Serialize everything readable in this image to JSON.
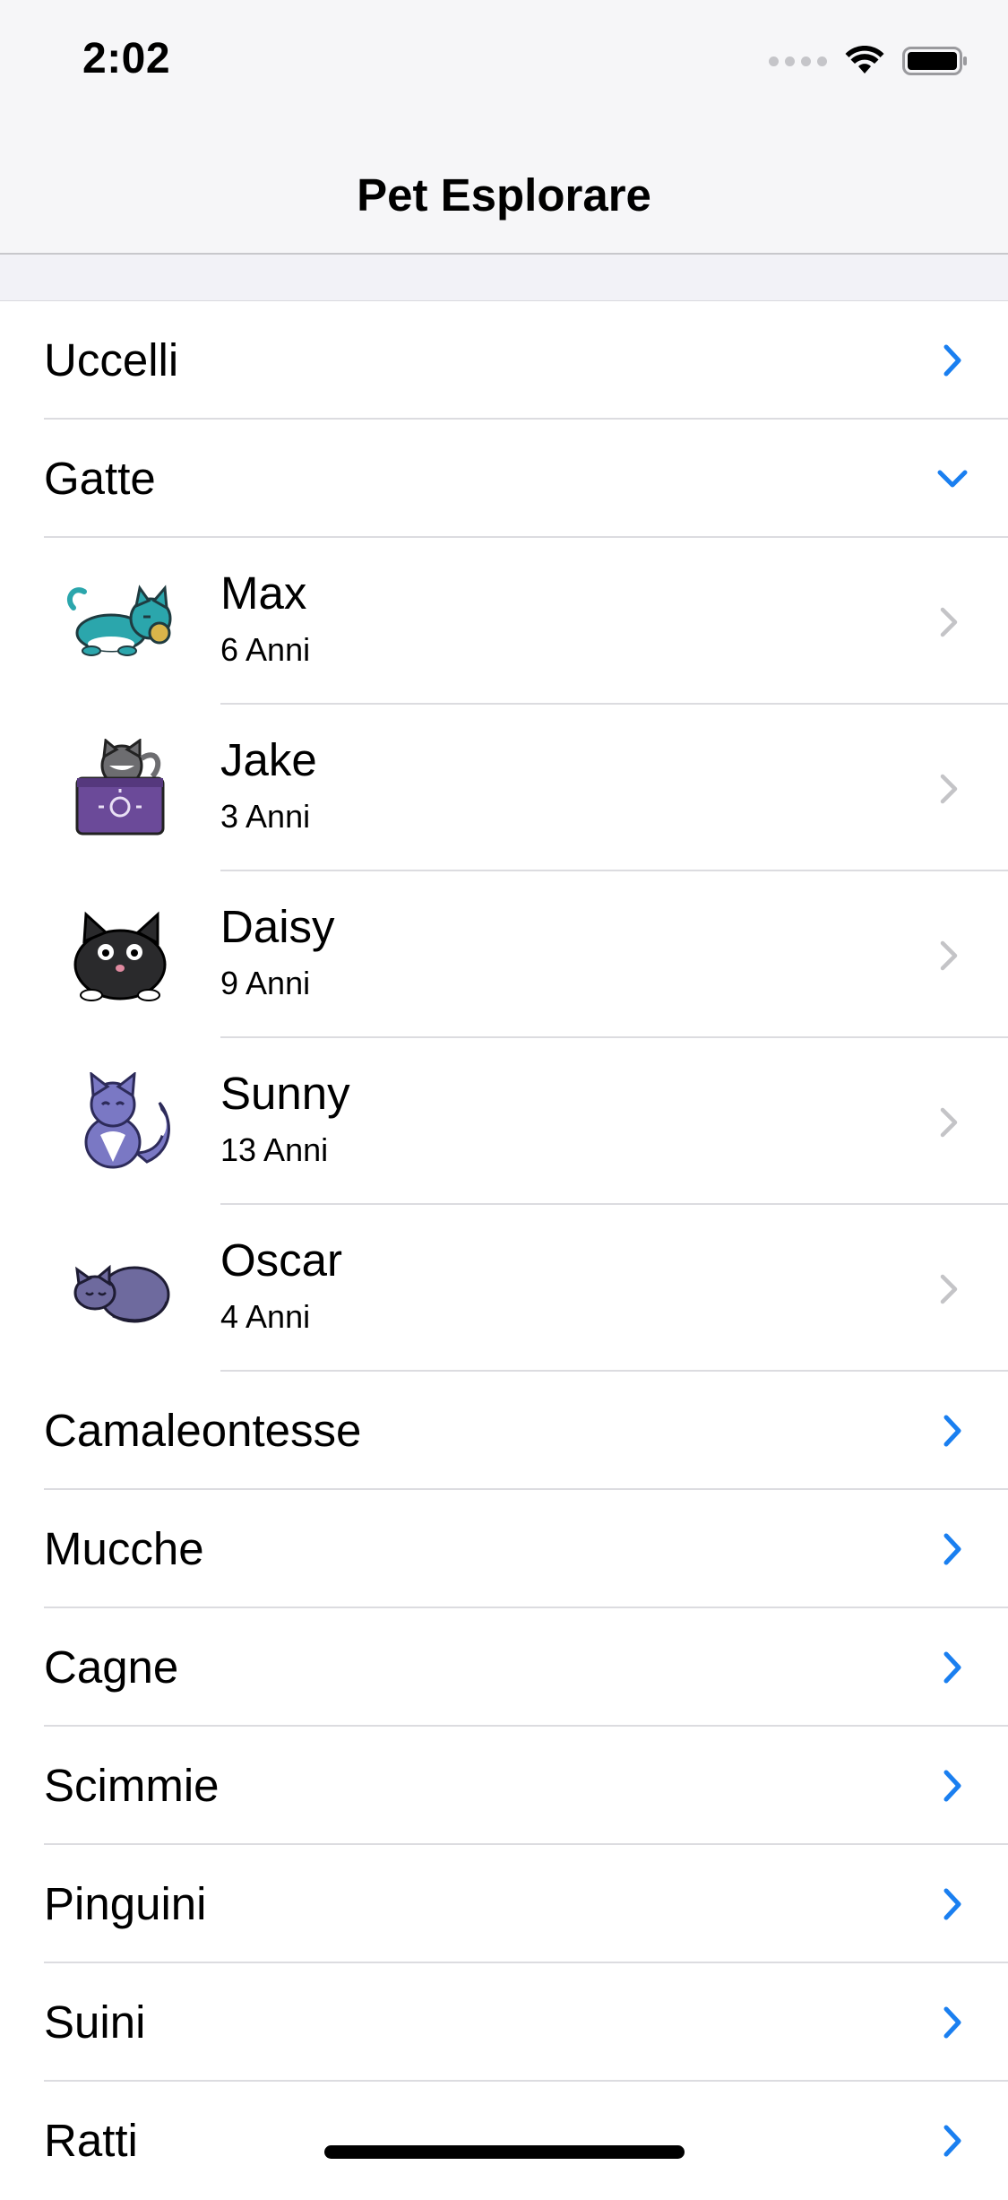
{
  "status_bar": {
    "time": "2:02"
  },
  "nav": {
    "title": "Pet Esplorare"
  },
  "colors": {
    "accent": "#1a7ff0",
    "chevron_gray": "#c4c4c7"
  },
  "categories_before": [
    {
      "label": "Uccelli",
      "expanded": false
    }
  ],
  "expanded_category": {
    "label": "Gatte",
    "expanded": true
  },
  "pets": [
    {
      "name": "Max",
      "age": "6 Anni",
      "icon": "teal-cat-icon"
    },
    {
      "name": "Jake",
      "age": "3 Anni",
      "icon": "cat-on-box-icon"
    },
    {
      "name": "Daisy",
      "age": "9 Anni",
      "icon": "black-cat-icon"
    },
    {
      "name": "Sunny",
      "age": "13 Anni",
      "icon": "purple-sitting-cat-icon"
    },
    {
      "name": "Oscar",
      "age": "4 Anni",
      "icon": "sleeping-cat-icon"
    }
  ],
  "categories_after": [
    {
      "label": "Camaleontesse",
      "expanded": false
    },
    {
      "label": "Mucche",
      "expanded": false
    },
    {
      "label": "Cagne",
      "expanded": false
    },
    {
      "label": "Scimmie",
      "expanded": false
    },
    {
      "label": "Pinguini",
      "expanded": false
    },
    {
      "label": "Suini",
      "expanded": false
    },
    {
      "label": "Ratti",
      "expanded": false
    }
  ]
}
